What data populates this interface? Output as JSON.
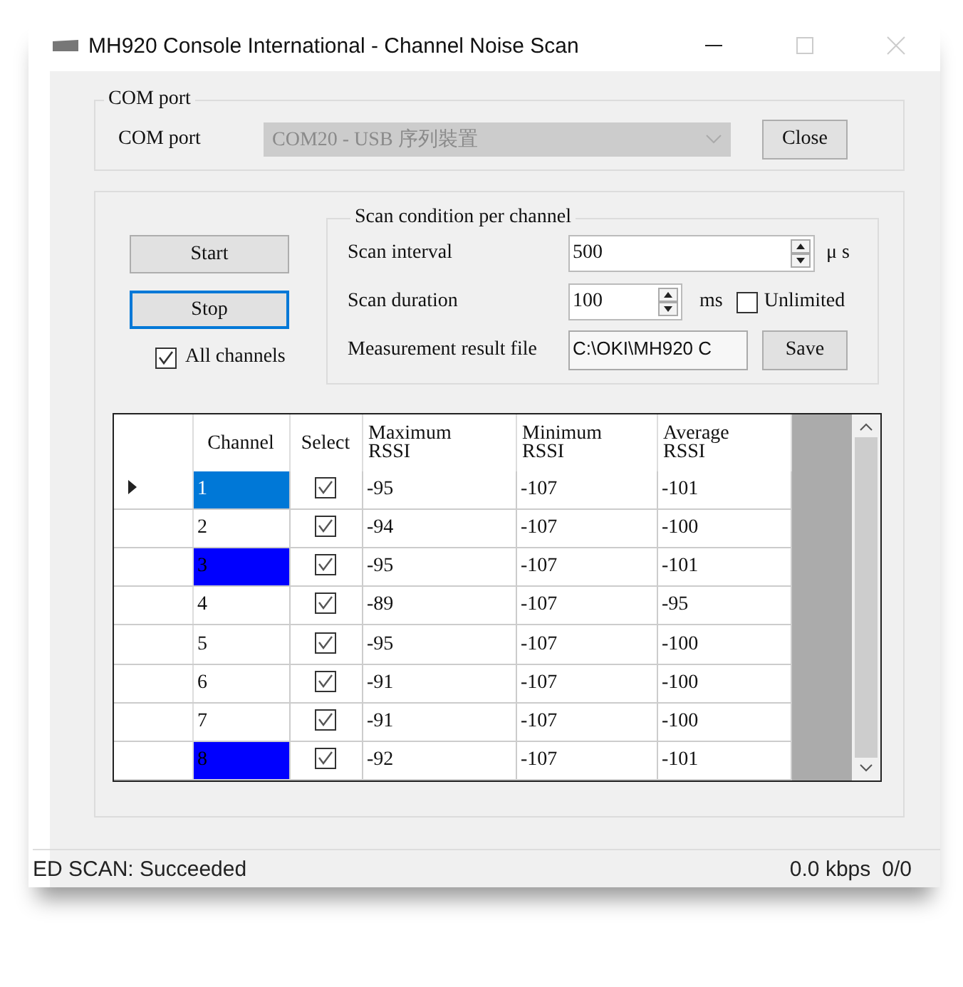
{
  "window": {
    "title": "MH920 Console International - Channel Noise Scan"
  },
  "com_port": {
    "legend": "COM port",
    "label": "COM port",
    "value": "COM20 - USB 序列裝置",
    "disabled": true,
    "button": "Close"
  },
  "scan": {
    "start_button": {
      "label": "Start",
      "focused": false
    },
    "stop_button": {
      "label": "Stop",
      "focused": true
    },
    "all_channels": {
      "label": "All channels",
      "checked": true
    },
    "condition": {
      "legend": "Scan condition per channel",
      "scan_interval": {
        "label": "Scan interval",
        "value": "500",
        "unit": "μ s"
      },
      "scan_duration": {
        "label": "Scan duration",
        "value": "100",
        "unit": "ms"
      },
      "unlimited": {
        "label": "Unlimited",
        "checked": false
      },
      "result_file": {
        "label": "Measurement result file",
        "value": "C:\\OKI\\MH920 C",
        "button": "Save"
      }
    }
  },
  "table": {
    "columns": [
      "Channel",
      "Select",
      "Maximum\nRSSI",
      "Minimum\nRSSI",
      "Average\nRSSI"
    ],
    "rows": [
      {
        "channel": "1",
        "selected": true,
        "checked": true,
        "max": "-95",
        "min": "-107",
        "avg": "-101"
      },
      {
        "channel": "2",
        "selected": false,
        "checked": true,
        "max": "-94",
        "min": "-107",
        "avg": "-100"
      },
      {
        "channel": "3",
        "selected": false,
        "color": "#0000ff",
        "checked": true,
        "max": "-95",
        "min": "-107",
        "avg": "-101"
      },
      {
        "channel": "4",
        "selected": false,
        "checked": true,
        "max": "-89",
        "min": "-107",
        "avg": "-95"
      },
      {
        "channel": "5",
        "selected": false,
        "checked": true,
        "max": "-95",
        "min": "-107",
        "avg": "-100"
      },
      {
        "channel": "6",
        "selected": false,
        "checked": true,
        "max": "-91",
        "min": "-107",
        "avg": "-100"
      },
      {
        "channel": "7",
        "selected": false,
        "checked": true,
        "max": "-91",
        "min": "-107",
        "avg": "-100"
      },
      {
        "channel": "8",
        "selected": false,
        "color": "#0000ff",
        "checked": true,
        "max": "-92",
        "min": "-107",
        "avg": "-101"
      }
    ]
  },
  "status_bar": {
    "message": "ED SCAN: Succeeded",
    "rate": "0.0 kbps",
    "count": "0/0"
  }
}
